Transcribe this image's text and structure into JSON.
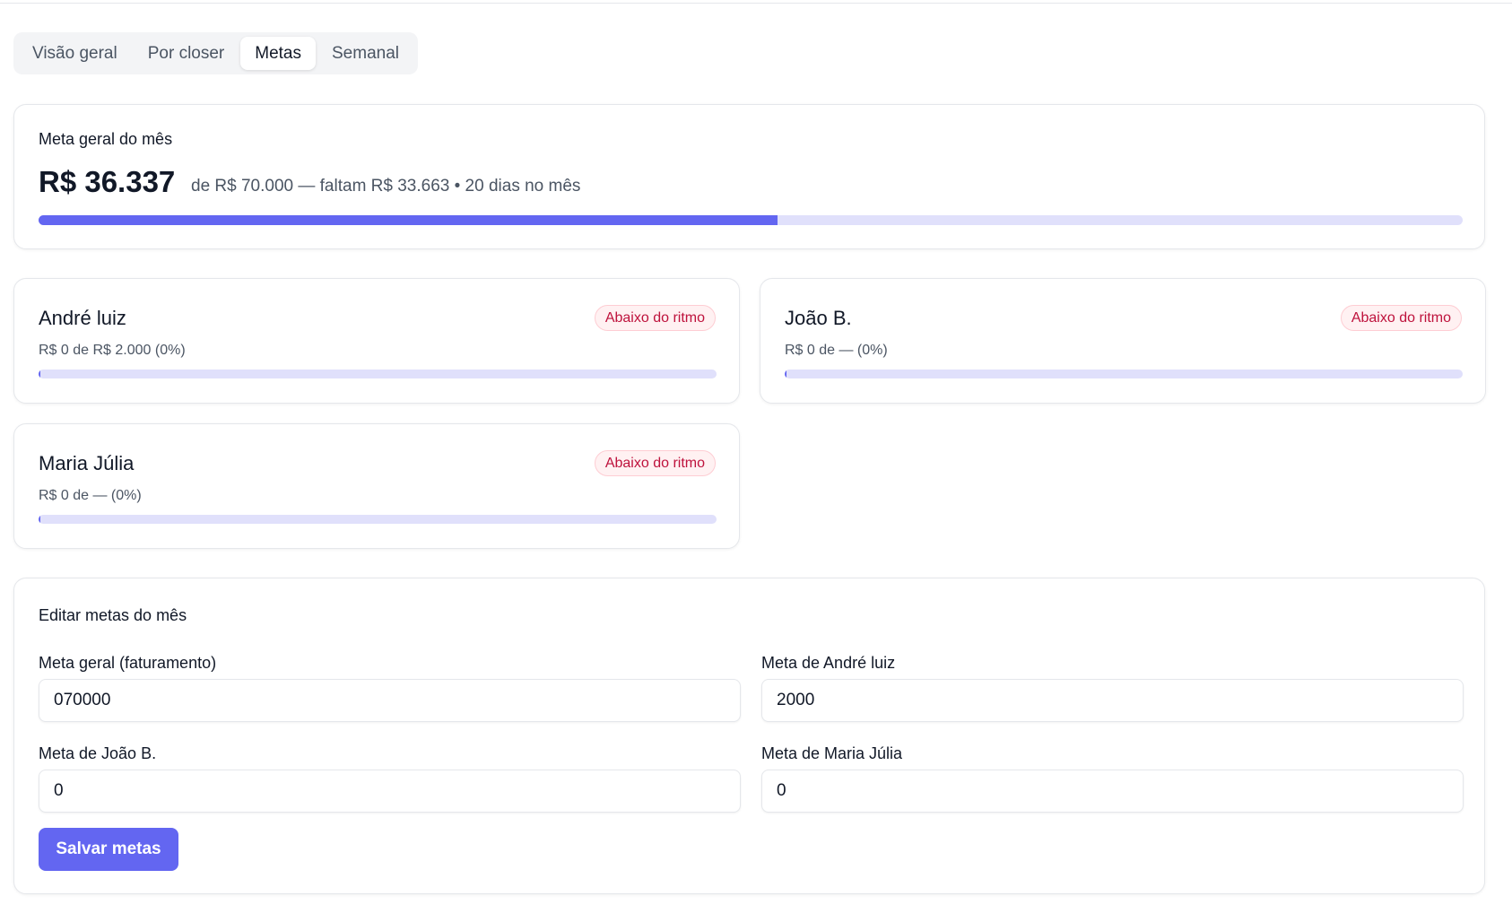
{
  "tabs": [
    {
      "label": "Visão geral",
      "active": false
    },
    {
      "label": "Por closer",
      "active": false
    },
    {
      "label": "Metas",
      "active": true
    },
    {
      "label": "Semanal",
      "active": false
    }
  ],
  "overall": {
    "title": "Meta geral do mês",
    "amount": "R$ 36.337",
    "subtitle": "de R$ 70.000 — faltam R$ 33.663 • 20 dias no mês",
    "progress": 0.519
  },
  "closers": [
    {
      "name": "André luiz",
      "status": "Abaixo do ritmo",
      "meta_text": "R$ 0 de R$ 2.000 (0%)",
      "progress": 0
    },
    {
      "name": "João B.",
      "status": "Abaixo do ritmo",
      "meta_text": "R$ 0 de — (0%)",
      "progress": 0
    },
    {
      "name": "Maria Júlia",
      "status": "Abaixo do ritmo",
      "meta_text": "R$ 0 de — (0%)",
      "progress": 0
    }
  ],
  "editor": {
    "title": "Editar metas do mês",
    "fields": [
      {
        "label": "Meta geral (faturamento)",
        "value": "070000"
      },
      {
        "label": "Meta de André luiz",
        "value": "2000"
      },
      {
        "label": "Meta de João B.",
        "value": "0"
      },
      {
        "label": "Meta de Maria Júlia",
        "value": "0"
      }
    ],
    "save_label": "Salvar metas"
  },
  "colors": {
    "accent": "#6366f1",
    "track": "#e0e0fb",
    "badge_text": "#be123c",
    "badge_bg": "#fff1f2"
  }
}
